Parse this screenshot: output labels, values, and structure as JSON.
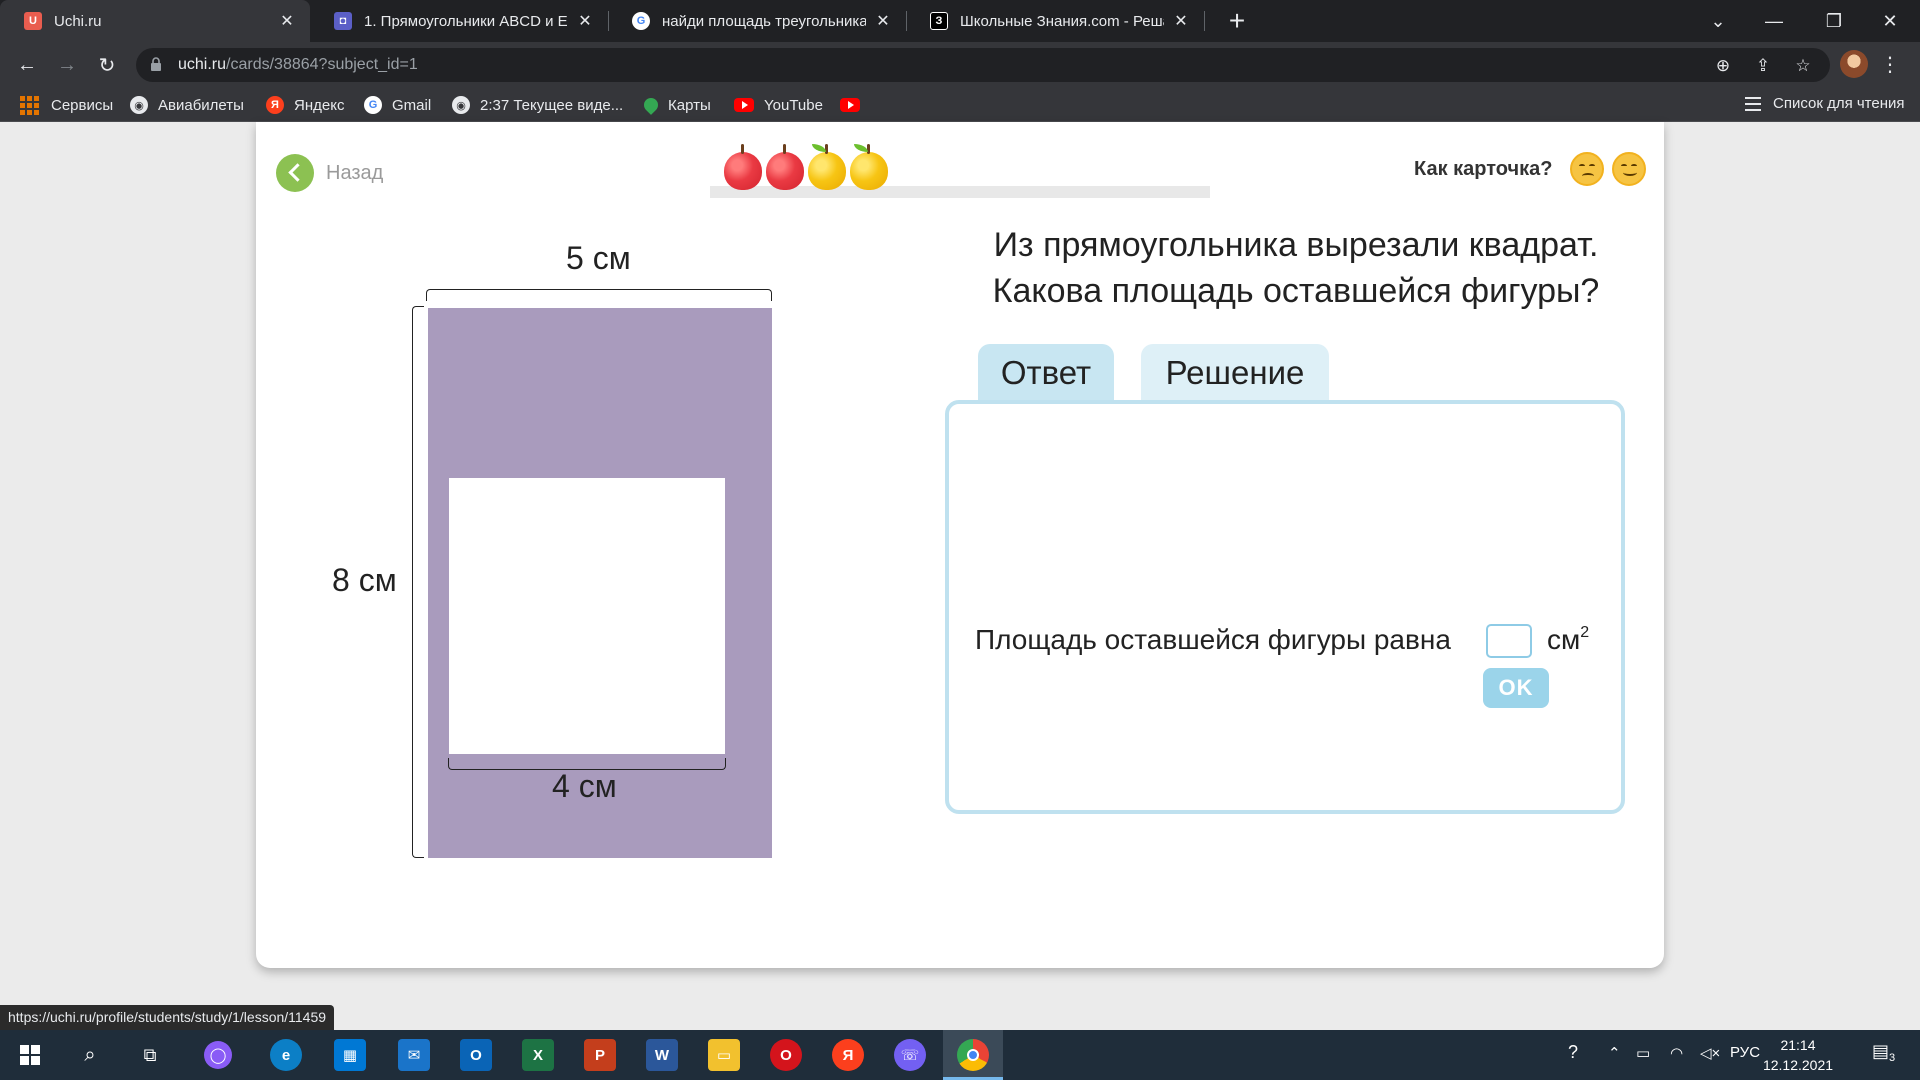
{
  "browser": {
    "tabs": [
      {
        "title": "Uchi.ru",
        "favicon_color": "#e95d4f",
        "active": true
      },
      {
        "title": "1. Прямоугольники ABCD и EBC",
        "favicon_color": "#5b5fc7",
        "active": false
      },
      {
        "title": "найди площадь треугольника -",
        "favicon_color": "#ffffff",
        "active": false
      },
      {
        "title": "Школьные Знания.com - Решае",
        "favicon_color": "#000000",
        "active": false
      }
    ],
    "url_host": "uchi.ru",
    "url_path": "/cards/38864?subject_id=1",
    "bookmarks": [
      {
        "label": "Сервисы",
        "icon": "apps-grid-icon"
      },
      {
        "label": "Авиабилеты",
        "icon": "globe-icon"
      },
      {
        "label": "Яндекс",
        "icon": "yandex-icon"
      },
      {
        "label": "Gmail",
        "icon": "google-icon"
      },
      {
        "label": "2:37 Текущее виде...",
        "icon": "globe-icon"
      },
      {
        "label": "Карты",
        "icon": "maps-pin-icon"
      },
      {
        "label": "YouTube",
        "icon": "youtube-icon"
      },
      {
        "label": "",
        "icon": "youtube-icon"
      }
    ],
    "reading_list": "Список для чтения",
    "status_url": "https://uchi.ru/profile/students/study/1/lesson/11459"
  },
  "card": {
    "back_label": "Назад",
    "rate_label": "Как карточка?",
    "apples": [
      "red",
      "red",
      "yellow",
      "yellow"
    ],
    "figure": {
      "top_label": "5 см",
      "left_label": "8 см",
      "bottom_label": "4 см",
      "rect_color": "#a99bbd"
    },
    "question_line1": "Из прямоугольника вырезали квадрат.",
    "question_line2": "Какова площадь оставшейся фигуры?",
    "tab_answer": "Ответ",
    "tab_solution": "Решение",
    "answer_text": "Площадь оставшейся фигуры равна",
    "answer_value": "",
    "unit": "см",
    "unit_sup": "2",
    "ok_label": "OK"
  },
  "taskbar": {
    "lang": "РУС",
    "time": "21:14",
    "date": "12.12.2021",
    "notif_count": "3"
  }
}
